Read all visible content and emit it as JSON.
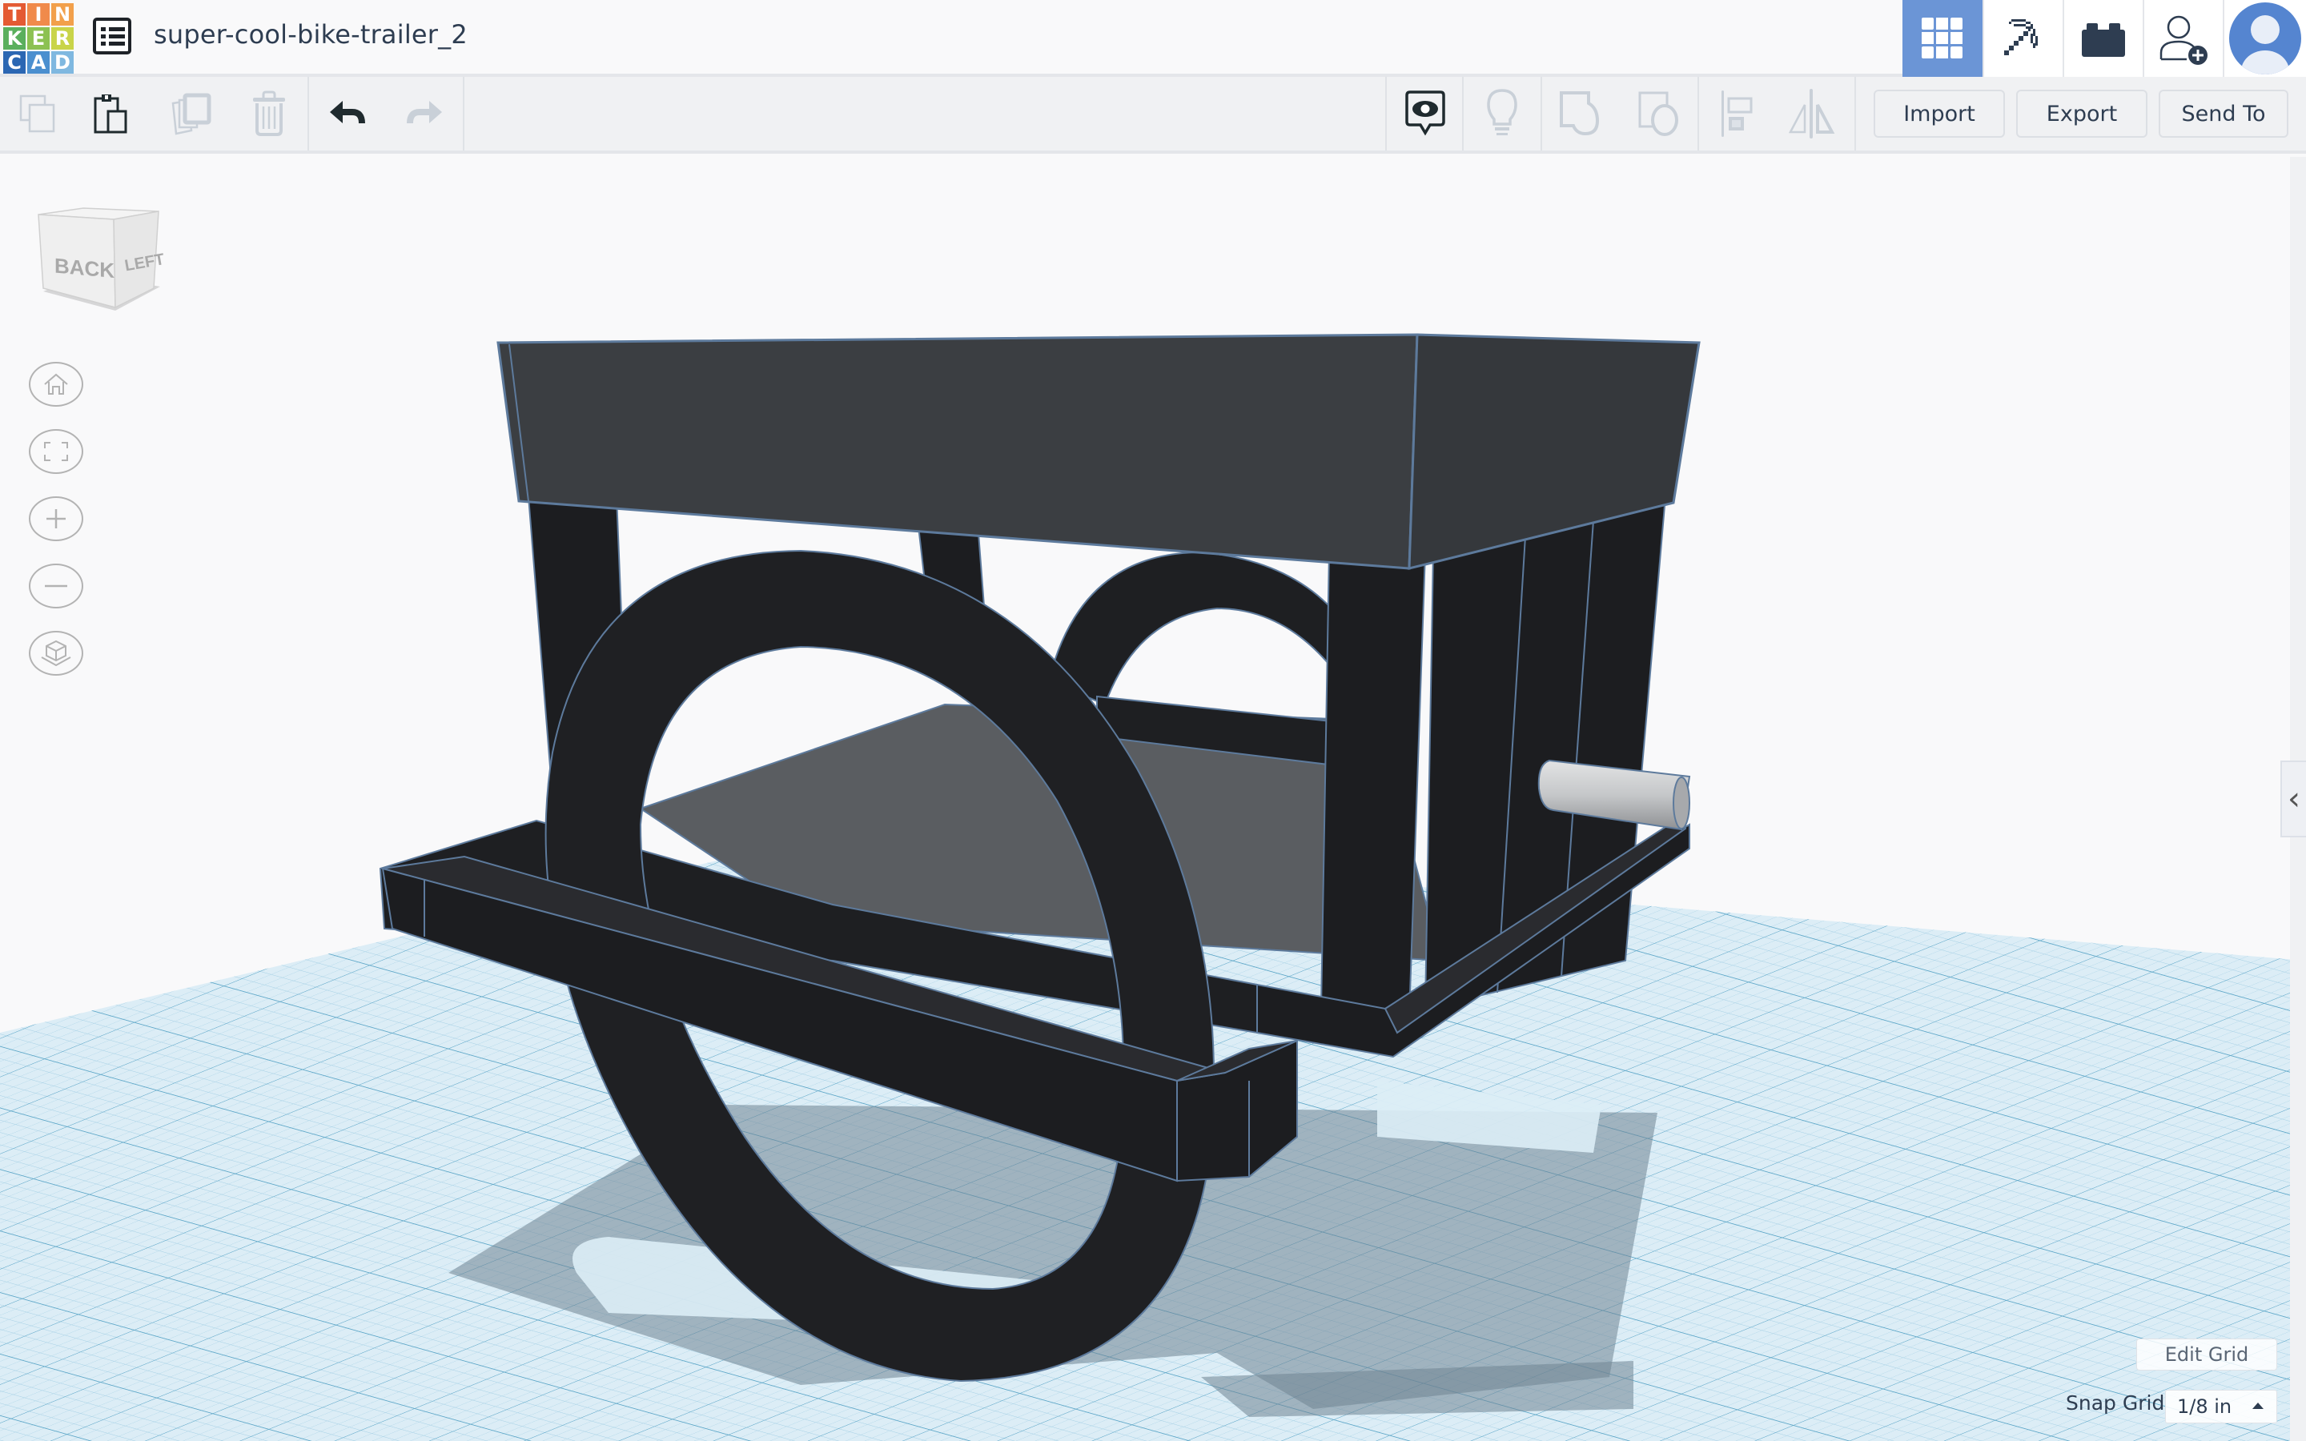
{
  "app": {
    "logo_letters": [
      "T",
      "I",
      "N",
      "K",
      "E",
      "R",
      "C",
      "A",
      "D"
    ],
    "logo_colors": [
      "#e45a33",
      "#f08a4b",
      "#f2a04b",
      "#5aaf5d",
      "#8cc152",
      "#c9d449",
      "#2b67b3",
      "#4b8fcf",
      "#7fb8e0"
    ],
    "document_title": "super-cool-bike-trailer_2"
  },
  "header": {
    "buttons": [
      {
        "name": "3d-design-view",
        "icon": "grid-icon",
        "active": true
      },
      {
        "name": "minecraft-bricks",
        "icon": "pickaxe-icon",
        "active": false
      },
      {
        "name": "lego-bricks",
        "icon": "brick-icon",
        "active": false
      },
      {
        "name": "invite-user",
        "icon": "add-user-icon",
        "active": false
      },
      {
        "name": "account",
        "icon": "avatar-icon",
        "active": false
      }
    ],
    "accent_color": "#6b95d6"
  },
  "toolbar": {
    "edit_tools": [
      {
        "name": "copy",
        "icon": "copy-icon",
        "enabled": false
      },
      {
        "name": "paste",
        "icon": "paste-icon",
        "enabled": true
      },
      {
        "name": "duplicate",
        "icon": "duplicate-icon",
        "enabled": false
      },
      {
        "name": "delete",
        "icon": "trash-icon",
        "enabled": false
      }
    ],
    "history_tools": [
      {
        "name": "undo",
        "icon": "undo-icon",
        "enabled": true
      },
      {
        "name": "redo",
        "icon": "redo-icon",
        "enabled": false
      }
    ],
    "view_tools": [
      {
        "name": "show-all",
        "icon": "eye-bubble-icon",
        "enabled": true
      },
      {
        "name": "hint",
        "icon": "lightbulb-icon",
        "enabled": false
      },
      {
        "name": "group",
        "icon": "group-icon",
        "enabled": false
      },
      {
        "name": "ungroup",
        "icon": "ungroup-icon",
        "enabled": false
      },
      {
        "name": "align",
        "icon": "align-icon",
        "enabled": false
      },
      {
        "name": "mirror",
        "icon": "mirror-icon",
        "enabled": false
      }
    ],
    "import_label": "Import",
    "export_label": "Export",
    "send_to_label": "Send To"
  },
  "viewcube": {
    "front_face": "BACK",
    "side_face": "LEFT"
  },
  "nav_controls": [
    {
      "name": "home-view",
      "icon": "home-icon"
    },
    {
      "name": "fit-view",
      "icon": "fit-icon"
    },
    {
      "name": "zoom-in",
      "icon": "plus-icon"
    },
    {
      "name": "zoom-out",
      "icon": "minus-icon"
    },
    {
      "name": "perspective",
      "icon": "cube-icon"
    }
  ],
  "workplane": {
    "edit_grid_label": "Edit Grid",
    "snap_grid_label": "Snap Grid",
    "snap_grid_value": "1/8 in",
    "grid_color": "#d9ecf5",
    "model_color": "#1c1d20",
    "edge_color": "#5d7a9c"
  },
  "side_panel_toggle": "‹"
}
